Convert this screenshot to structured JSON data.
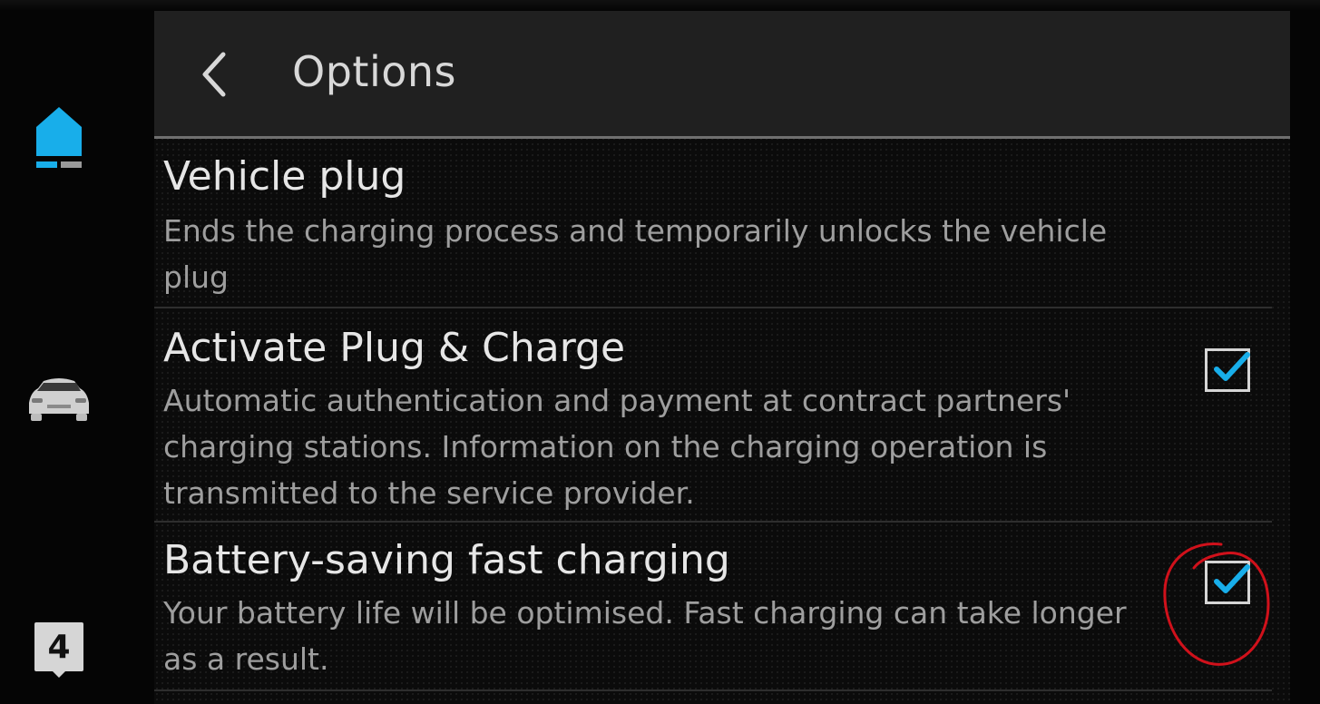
{
  "header": {
    "title": "Options"
  },
  "rail": {
    "badge": "4",
    "icons": [
      "home-icon",
      "car-icon"
    ],
    "accent_color": "#18aeea"
  },
  "options": [
    {
      "title": "Vehicle plug",
      "description": "Ends the charging process and temporarily unlocks the vehicle plug"
    },
    {
      "title": "Activate Plug & Charge",
      "description": "Automatic authentication and payment at contract partners' charging stations. Information on the charging operation is transmitted to the service provider.",
      "checked": true
    },
    {
      "title": "Battery-saving fast charging",
      "description": "Your battery life will be optimised. Fast charging can take longer as a result.",
      "checked": true,
      "annotation_color": "#d0111b"
    }
  ]
}
